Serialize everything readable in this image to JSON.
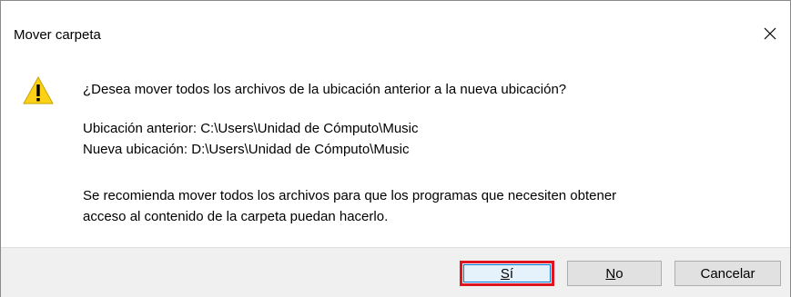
{
  "window": {
    "title": "Mover carpeta",
    "close_label": "✕"
  },
  "message": {
    "question": "¿Desea mover todos los archivos de la ubicación anterior a la nueva ubicación?",
    "old_location": "Ubicación anterior: C:\\Users\\Unidad de Cómputo\\Music",
    "new_location": "Nueva ubicación: D:\\Users\\Unidad de Cómputo\\Music",
    "recommendation_line1": "Se recomienda mover todos los archivos para que los programas que necesiten obtener",
    "recommendation_line2": "acceso al contenido de la carpeta puedan hacerlo."
  },
  "buttons": {
    "yes_mnemonic": "S",
    "yes_rest": "í",
    "no_mnemonic": "N",
    "no_rest": "o",
    "cancel": "Cancelar"
  },
  "icons": {
    "warning": "warning-icon",
    "close": "close-icon"
  },
  "colors": {
    "warning_fill": "#fcd116",
    "highlight_border": "#e0141e",
    "focus_border": "#0078d7",
    "footer_bg": "#f0f0f0"
  }
}
